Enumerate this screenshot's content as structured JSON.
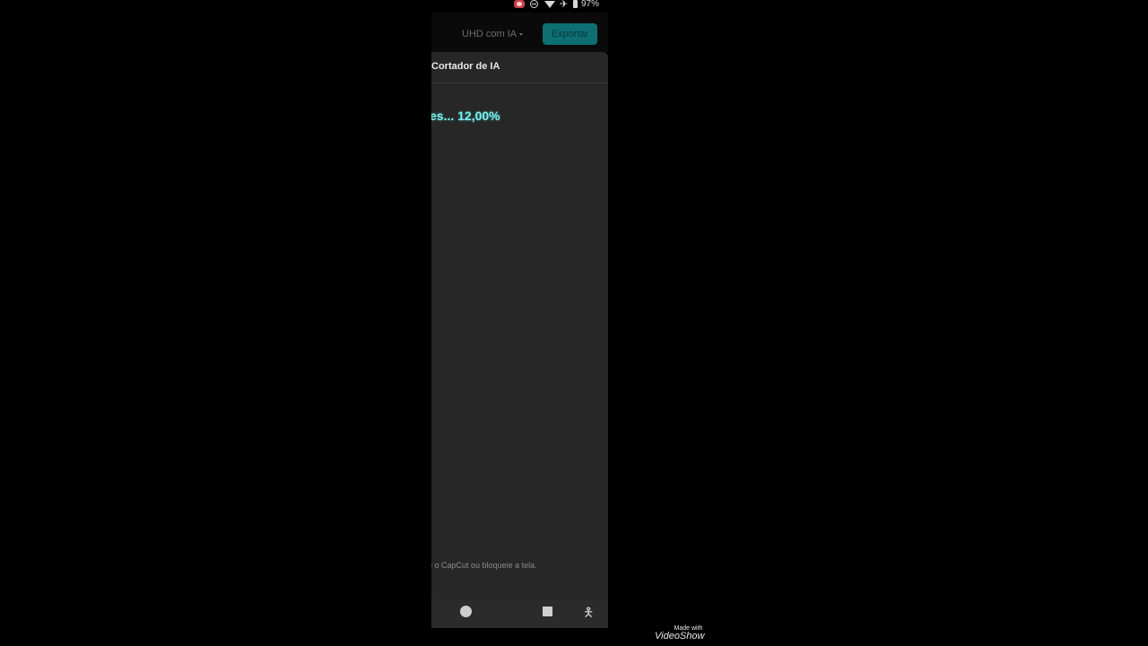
{
  "status_bar": {
    "battery": "97%",
    "icons": [
      "screen-record-icon",
      "do-not-disturb-icon",
      "wifi-icon",
      "airplane-icon",
      "battery-icon"
    ]
  },
  "header": {
    "quality_label": "UHD com IA",
    "export_label": "Exportar",
    "accent_color": "#0d6f72"
  },
  "panel": {
    "title": "Cortador de IA",
    "progress_text": "es... 12,00%",
    "hint_text": "e o CapCut ou bloqueie a tela."
  },
  "nav": {
    "icons": [
      "home-icon",
      "recents-icon",
      "accessibility-icon"
    ]
  },
  "watermark": {
    "small": "Made with",
    "brand": "VideoShow"
  }
}
